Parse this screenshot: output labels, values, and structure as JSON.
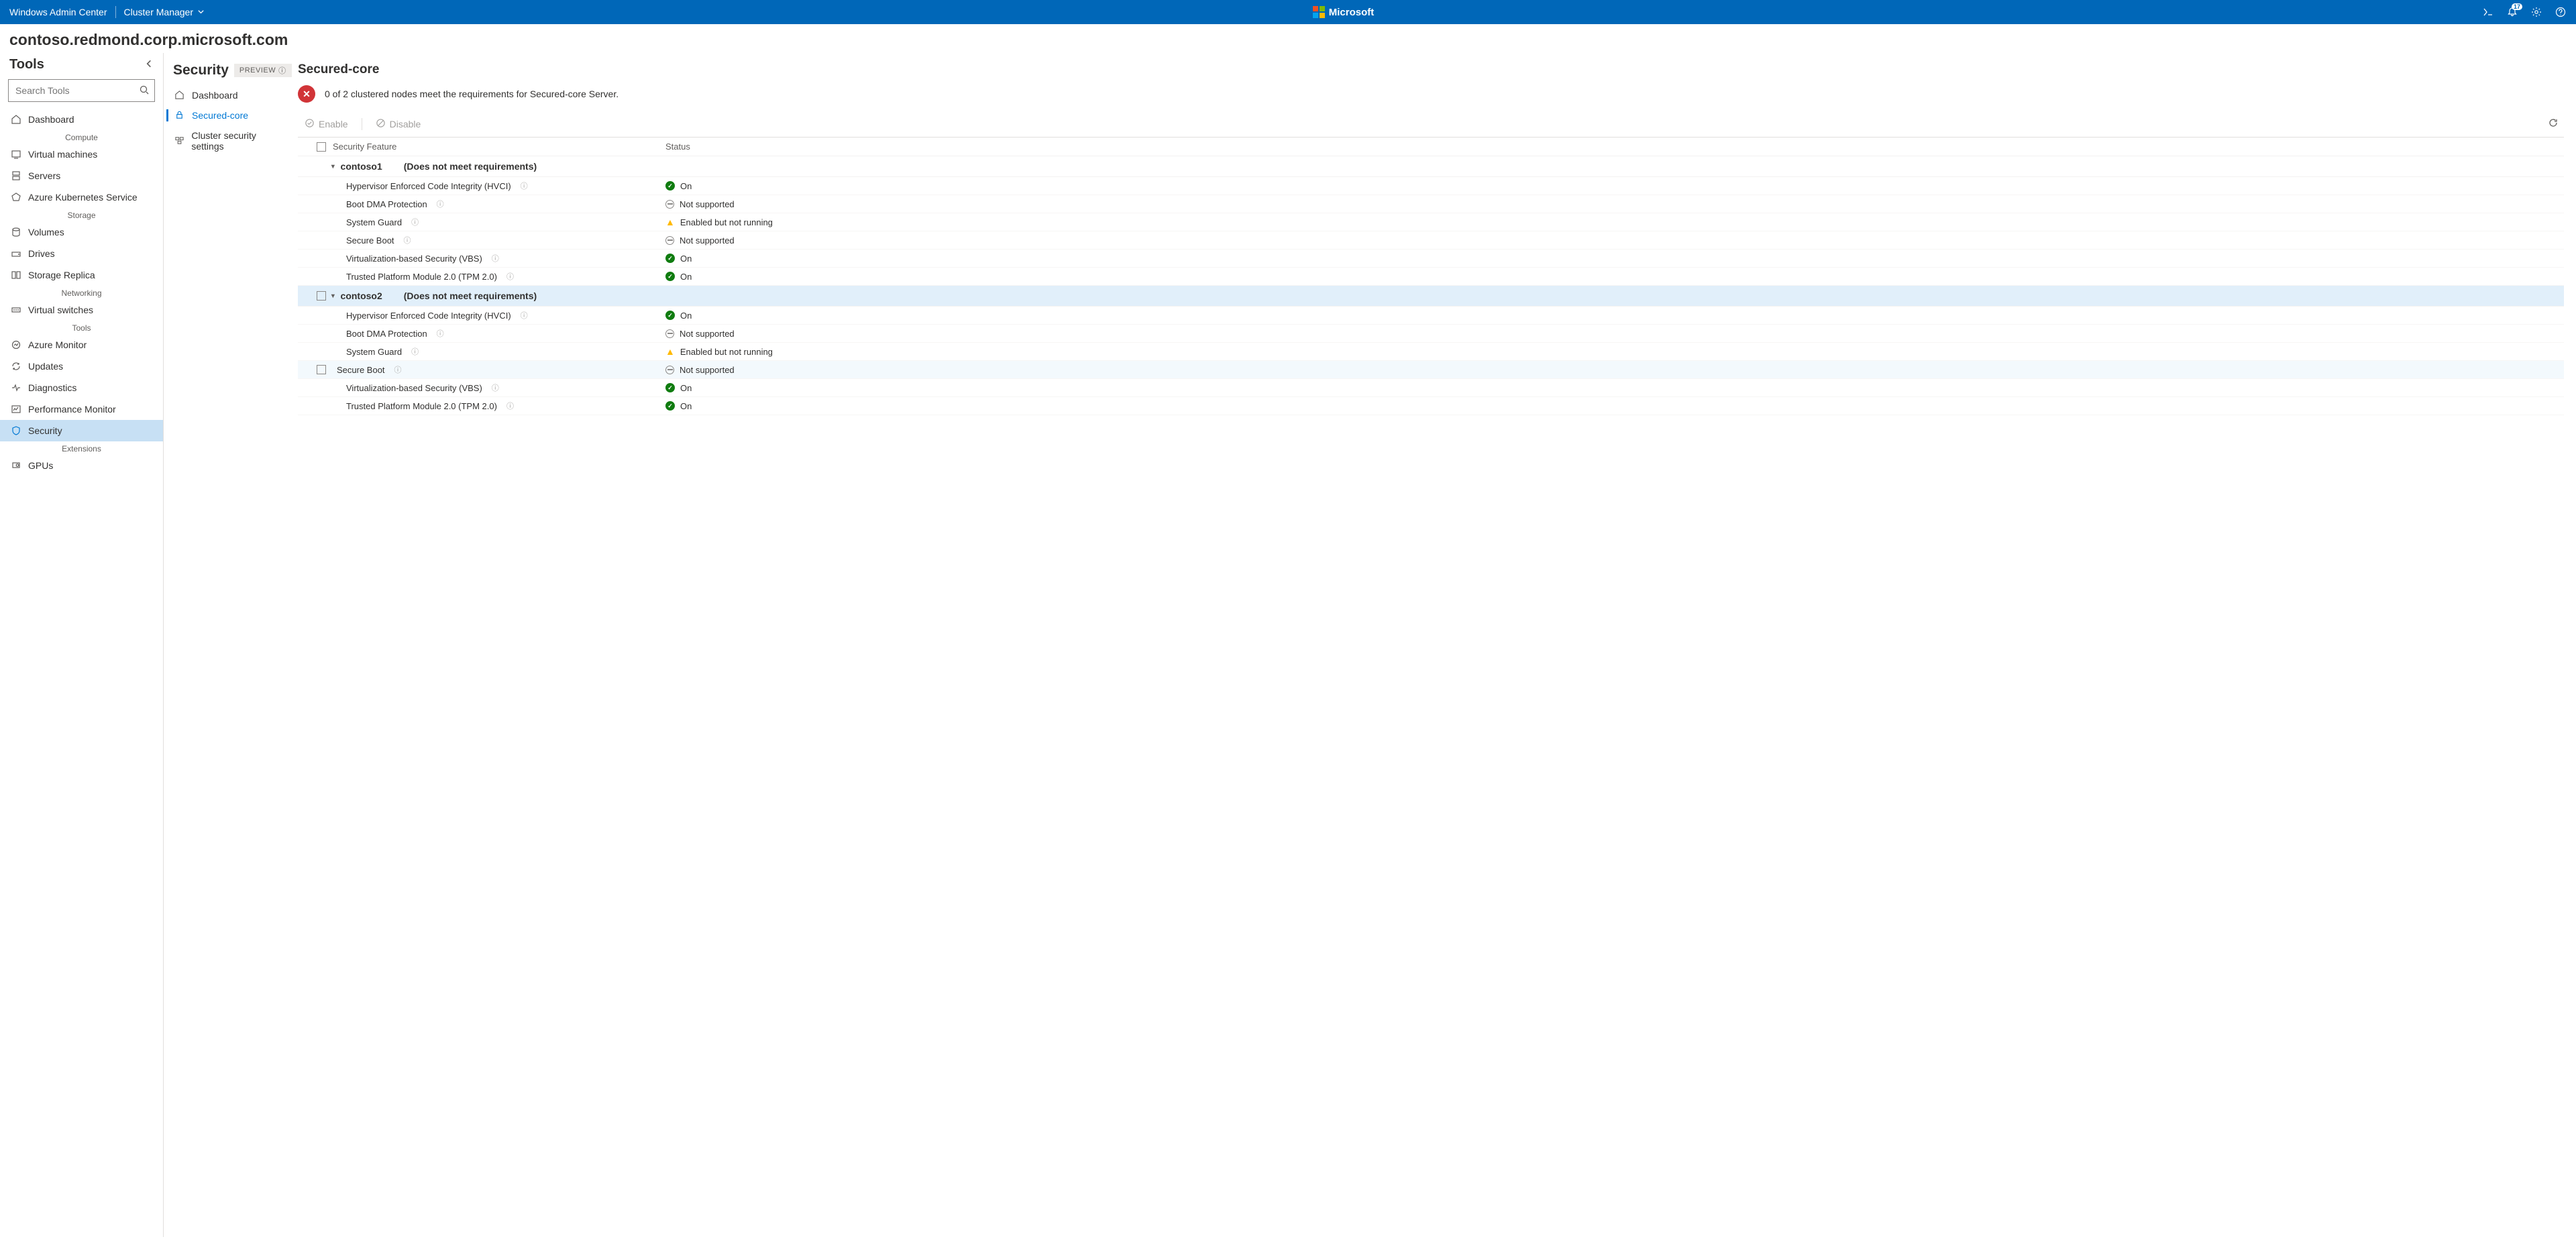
{
  "topbar": {
    "product": "Windows Admin Center",
    "scope": "Cluster Manager",
    "brand": "Microsoft",
    "notification_count": "17"
  },
  "connection": {
    "host": "contoso.redmond.corp.microsoft.com"
  },
  "tools": {
    "title": "Tools",
    "search_placeholder": "Search Tools",
    "groups": {
      "compute": "Compute",
      "storage": "Storage",
      "networking": "Networking",
      "tools": "Tools",
      "extensions": "Extensions"
    },
    "items": {
      "dashboard": "Dashboard",
      "vms": "Virtual machines",
      "servers": "Servers",
      "aks": "Azure Kubernetes Service",
      "volumes": "Volumes",
      "drives": "Drives",
      "storage_replica": "Storage Replica",
      "vswitches": "Virtual switches",
      "azure_monitor": "Azure Monitor",
      "updates": "Updates",
      "diagnostics": "Diagnostics",
      "perfmon": "Performance Monitor",
      "security": "Security",
      "gpus": "GPUs"
    }
  },
  "subnav": {
    "title": "Security",
    "preview": "PREVIEW",
    "dashboard": "Dashboard",
    "secured_core": "Secured-core",
    "cluster_security": "Cluster security settings"
  },
  "main": {
    "title": "Secured-core",
    "banner": "0 of 2 clustered nodes meet the requirements for Secured-core Server.",
    "enable": "Enable",
    "disable": "Disable",
    "col_feature": "Security Feature",
    "col_status": "Status",
    "note": "(Does not meet requirements)",
    "nodes": {
      "n1": "contoso1",
      "n2": "contoso2"
    },
    "features": {
      "hvci": "Hypervisor Enforced Code Integrity (HVCI)",
      "dma": "Boot DMA Protection",
      "sysguard": "System Guard",
      "secureboot": "Secure Boot",
      "vbs": "Virtualization-based Security (VBS)",
      "tpm": "Trusted Platform Module 2.0 (TPM 2.0)"
    },
    "status": {
      "on": "On",
      "not_supported": "Not supported",
      "enabled_not_running": "Enabled but not running"
    }
  }
}
